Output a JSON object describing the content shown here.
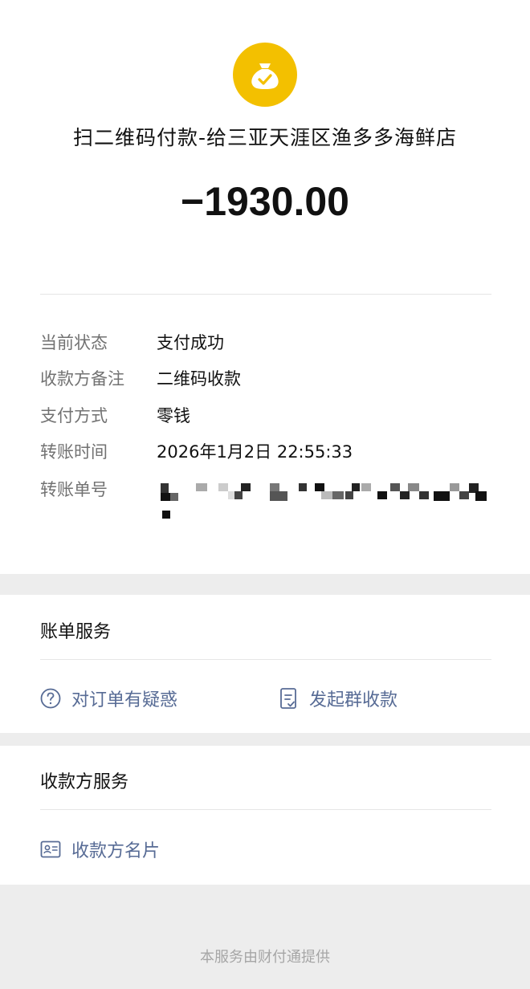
{
  "payment": {
    "merchant": "扫二维码付款-给三亚天涯区渔多多海鲜店",
    "amount": "−1930.00"
  },
  "details": {
    "status_label": "当前状态",
    "status_value": "支付成功",
    "remark_label": "收款方备注",
    "remark_value": "二维码收款",
    "method_label": "支付方式",
    "method_value": "零钱",
    "time_label": "转账时间",
    "time_value": "2026年1月2日 22:55:33",
    "order_label": "转账单号"
  },
  "bill_services": {
    "title": "账单服务",
    "question_link": "对订单有疑惑",
    "group_collect_link": "发起群收款"
  },
  "payee_services": {
    "title": "收款方服务",
    "card_link": "收款方名片"
  },
  "footer": {
    "text": "本服务由财付通提供"
  },
  "colors": {
    "accent_yellow": "#f3c000",
    "link_blue": "#576b95"
  }
}
